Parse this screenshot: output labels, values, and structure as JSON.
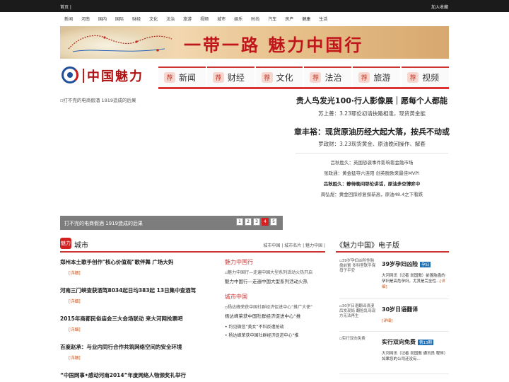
{
  "topbar": {
    "home": "首页 |",
    "favorite": "加入收藏"
  },
  "nav": [
    "新闻",
    "河南",
    "国内",
    "国际",
    "财经",
    "文化",
    "法治",
    "旅游",
    "视频",
    "城市",
    "娱乐",
    "时尚",
    "汽车",
    "房产",
    "健康",
    "生活"
  ],
  "banner": {
    "slogan": "一带一路 魅力中国行"
  },
  "logo": {
    "text": "中国魅力"
  },
  "categories": [
    {
      "stamp": "荐",
      "label": "新闻"
    },
    {
      "stamp": "荐",
      "label": "财经"
    },
    {
      "stamp": "荐",
      "label": "文化"
    },
    {
      "stamp": "荐",
      "label": "法治"
    },
    {
      "stamp": "荐",
      "label": "旅游"
    },
    {
      "stamp": "荐",
      "label": "视频"
    }
  ],
  "slideshow": {
    "image_alt": "打不完的电商假酒 1919造成的后果",
    "caption": "打不完的电商假酒 1919造成的后果",
    "pages": [
      "1",
      "2",
      "3",
      "4",
      "5"
    ],
    "active_page": 4
  },
  "headlines": {
    "h1": "贵人鸟发光100·行人影像展｜愿每个人都能",
    "s1": "苏上善：3.23耶伦初请抉路相逢，现货黄金能",
    "h2": "章丰裕：现货原油历经大起大落，按兵不动或",
    "s2": "罗政财：3.23现货黄金、原油晚间操作、解套"
  },
  "links": [
    {
      "text": "吕秋胜久：英国恐袭事件影响看金融市场",
      "bold": false
    },
    {
      "text": "张政通：黄金猛夺六连阳 创英脱欧来最佳MVP!",
      "bold": false
    },
    {
      "text": "吕秋胜久：静待晚间耶伦讲话，原油多空博弈中",
      "bold": true
    },
    {
      "text": "周弘煜：黄金回踩修复探新高，原油48.4之下看跌",
      "bold": false
    }
  ],
  "city": {
    "badge": "魅力",
    "title": "城市",
    "tabs": "城市中国 |  城市名片 |  魅力中国 |",
    "items": [
      {
        "title": "郑州本土歌手创作\"核心价值观\"歌伴舞 广场大妈",
        "more": "[详细]"
      },
      {
        "title": "河南三门峡查获酒驾8034起日均383起 13日集中查酒驾",
        "more": "[详细]"
      },
      {
        "title": "2015年商都民俗庙会三大会场联动 来大河网抢票吧",
        "more": "[详细]"
      },
      {
        "title": "百度赵承：与业内同行合作共筑网络空间的安全环境",
        "more": "[详细]"
      },
      {
        "title": "“中国网事•感动河南2014”年度网络人物颁奖礼举行",
        "more": ""
      }
    ],
    "right": {
      "h1": "魅力中国行",
      "img1": "魅力中国行—走遍中国大型系列活动火热开启",
      "line1": "魅力中国行—走遍中国大型系列活动火热",
      "h2": "城市中国",
      "img2": "杨达峰荣获中国社群经济促进中心“推广大使”",
      "line2": "杨达峰荣获中国社群经济促进中心“推",
      "li1": "• 约见微信“美女”不料反遭抢劫",
      "li2": "• 杨达峰荣获中国社群经济促进中心“推"
    }
  },
  "emag": {
    "title": "《魅力中国》电子版",
    "items": [
      {
        "photo": "39岁孕妇凶险性胎盘前置 多科室联手保母子平安",
        "title": "39岁孕妇凶险",
        "tag": "孕妇",
        "desc": "大河网讯（记者 尚国傲）前置胎盘的孕妇是高危孕妇，尤其是完全性...",
        "more": "[详细]"
      },
      {
        "photo": "30岁日语翻译浪漫后发现妈 翻脸乱骂现方无法再生",
        "title": "30岁日语翻译",
        "tag": "",
        "desc": "",
        "more": "[详细]"
      },
      {
        "photo": "实行双向免费",
        "title": "实行双向免费",
        "tag": "第13期",
        "desc": "大河网讯（记者 尚国傲 通讯员 程恒）如果您的公司还没有...",
        "more": ""
      }
    ]
  },
  "colors": {
    "accent": "#d32020",
    "link_more": "#c7541a",
    "tag_blue": "#1e6fb6",
    "topbar": "#1b1b1b"
  }
}
